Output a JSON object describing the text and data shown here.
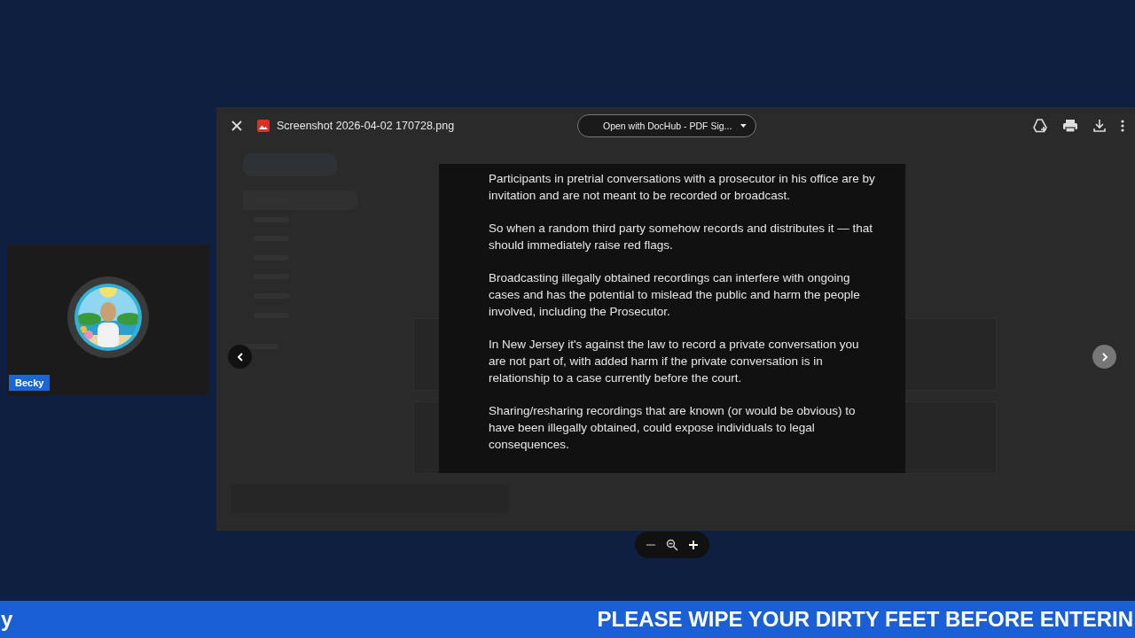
{
  "viewer": {
    "file_name": "Screenshot 2026-04-02 170728.png",
    "open_with": "Open with DocHub - PDF Sig...",
    "document_paragraphs": [
      "Participants in pretrial conversations with a prosecutor in his office are by invitation and are not meant to be recorded or broadcast.",
      "So when a random third party somehow records and distributes it — that should immediately raise red flags.",
      "Broadcasting illegally obtained recordings can interfere with ongoing cases and has the potential to mislead the public and harm the people involved, including the Prosecutor.",
      "In New Jersey it's against the law to record a private conversation you are not part of, with added harm if the private conversation is in relationship to a case currently before the court.",
      "Sharing/resharing recordings that are known (or would be obvious) to have been illegally obtained, could expose individuals to legal consequences."
    ]
  },
  "camera": {
    "name": "Becky"
  },
  "ticker": {
    "left_text": "y",
    "text": "PLEASE WIPE YOUR DIRTY FEET BEFORE ENTERIN"
  }
}
